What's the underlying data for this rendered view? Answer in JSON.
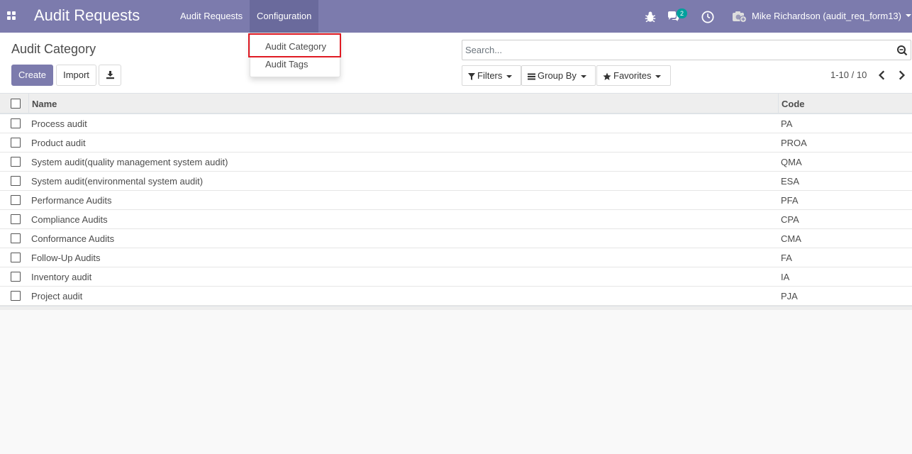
{
  "navbar": {
    "app_title": "Audit Requests",
    "menu": [
      {
        "label": "Audit Requests"
      },
      {
        "label": "Configuration"
      }
    ],
    "messages_count": "2",
    "user_name": "Mike Richardson (audit_req_form13)"
  },
  "config_dropdown": {
    "items": [
      {
        "label": "Audit Category"
      },
      {
        "label": "Audit Tags"
      }
    ]
  },
  "control_panel": {
    "breadcrumb": "Audit Category",
    "create_label": "Create",
    "import_label": "Import",
    "search_placeholder": "Search...",
    "filters_label": "Filters",
    "groupby_label": "Group By",
    "favorites_label": "Favorites",
    "pager": "1-10 / 10"
  },
  "list": {
    "columns": {
      "name": "Name",
      "code": "Code"
    },
    "rows": [
      {
        "name": "Process audit",
        "code": "PA"
      },
      {
        "name": "Product audit",
        "code": "PROA"
      },
      {
        "name": "System audit(quality management system audit)",
        "code": "QMA"
      },
      {
        "name": "System audit(environmental system audit)",
        "code": "ESA"
      },
      {
        "name": "Performance Audits",
        "code": "PFA"
      },
      {
        "name": "Compliance Audits",
        "code": "CPA"
      },
      {
        "name": "Conformance Audits",
        "code": "CMA"
      },
      {
        "name": "Follow-Up Audits",
        "code": "FA"
      },
      {
        "name": "Inventory audit",
        "code": "IA"
      },
      {
        "name": "Project audit",
        "code": "PJA"
      }
    ]
  },
  "colors": {
    "brand": "#7c7bad",
    "badge": "#00a09d",
    "highlight": "#e01b24"
  }
}
